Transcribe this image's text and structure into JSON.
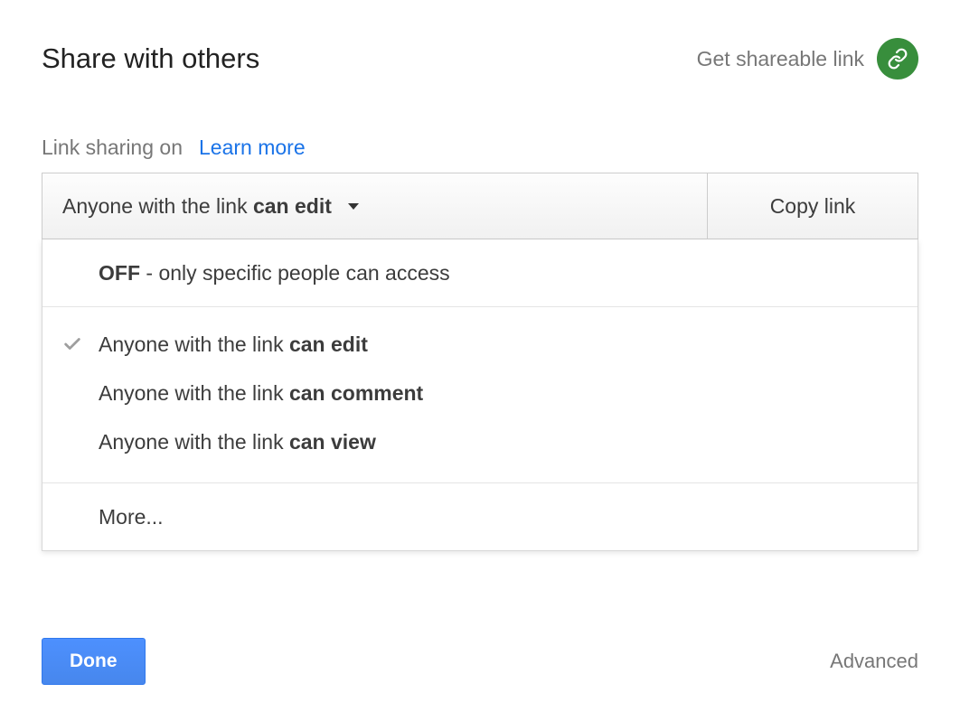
{
  "header": {
    "title": "Share with others",
    "shareable_link_label": "Get shareable link"
  },
  "status": {
    "text": "Link sharing on",
    "learn_more": "Learn more"
  },
  "dropdown": {
    "selected_prefix": "Anyone with the link ",
    "selected_bold": "can edit",
    "copy_label": "Copy link"
  },
  "menu": {
    "off_bold": "OFF",
    "off_suffix": " - only specific people can access",
    "opt1_prefix": "Anyone with the link ",
    "opt1_bold": "can edit",
    "opt2_prefix": "Anyone with the link ",
    "opt2_bold": "can comment",
    "opt3_prefix": "Anyone with the link ",
    "opt3_bold": "can view",
    "more": "More..."
  },
  "footer": {
    "done": "Done",
    "advanced": "Advanced"
  },
  "colors": {
    "accent_green": "#388e3c",
    "accent_blue": "#4d90fe",
    "link_blue": "#1a73e8"
  }
}
